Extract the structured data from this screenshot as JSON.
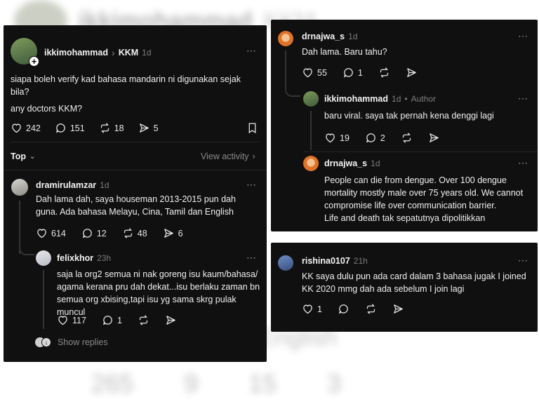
{
  "backdrop": {
    "name": "ikkimohammad",
    "page": "KKM",
    "side_text": "mil dan English",
    "counts": [
      "265",
      "9",
      "15",
      "3"
    ]
  },
  "post": {
    "author": "ikkimohammad",
    "page": "KKM",
    "time": "1d",
    "text1": "siapa boleh verify kad bahasa mandarin ni digunakan sejak bila?",
    "text2": "any doctors KKM?",
    "likes": "242",
    "comments": "151",
    "reposts": "18",
    "shares": "5",
    "sort_label": "Top",
    "view_activity": "View activity"
  },
  "reply1": {
    "author": "dramirulamzar",
    "time": "1d",
    "text": "Dah lama dah, saya houseman 2013-2015 pun dah guna. Ada bahasa Melayu, Cina, Tamil dan English",
    "likes": "614",
    "comments": "12",
    "reposts": "48",
    "shares": "6"
  },
  "reply1a": {
    "author": "felixkhor",
    "time": "23h",
    "text": "saja la org2 semua ni nak goreng isu kaum/bahasa/ agama kerana pru dah dekat...isu berlaku zaman bn semua org xbising,tapi isu yg sama skrg pulak muncul",
    "likes": "117",
    "comments": "1",
    "show_replies": "Show replies"
  },
  "reply2": {
    "author": "drnajwa_s",
    "time": "1d",
    "text": "Dah lama. Baru tahu?",
    "likes": "55",
    "comments": "1"
  },
  "reply2a": {
    "author": "ikkimohammad",
    "time": "1d",
    "author_badge": "Author",
    "text": "baru viral. saya tak pernah kena denggi lagi",
    "likes": "19",
    "comments": "2"
  },
  "reply2b": {
    "author": "drnajwa_s",
    "time": "1d",
    "text": "People can die from dengue. Over 100 dengue mortality mostly male over 75 years old. We cannot compromise life over communication barrier.",
    "text2": "Life and death tak sepatutnya dipolitikkan"
  },
  "reply3": {
    "author": "rishina0107",
    "time": "21h",
    "text": "KK saya dulu pun ada card dalam 3 bahasa jugak I joined KK 2020 mmg dah ada sebelum I join lagi",
    "likes": "1"
  },
  "icons": {
    "more": "⋯",
    "chevron": "›"
  },
  "colors": {
    "panel_bg": "#101010",
    "muted": "#8a8a8a"
  }
}
